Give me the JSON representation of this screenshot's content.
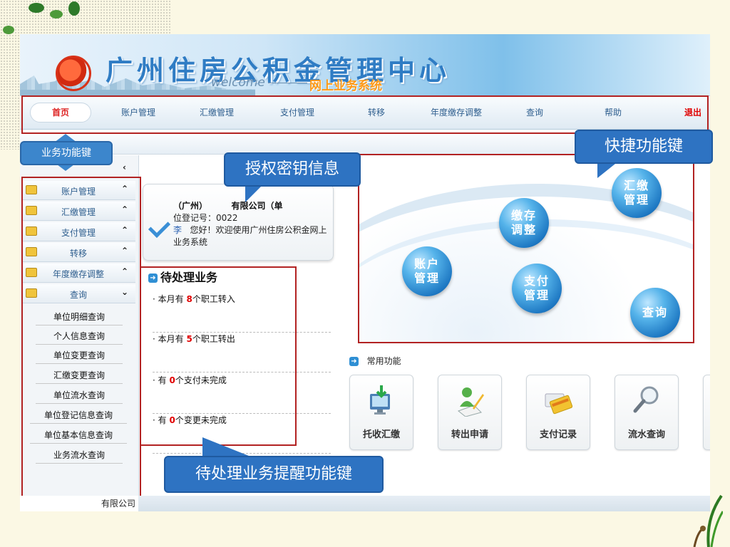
{
  "header": {
    "site_title": "广州住房公积金管理中心",
    "welcome": "welcome",
    "subtitle": "网上业务系统"
  },
  "nav": {
    "home": "首页",
    "items": [
      "账户管理",
      "汇缴管理",
      "支付管理",
      "转移",
      "年度缴存调整",
      "查询",
      "帮助"
    ],
    "exit": "退出"
  },
  "sidebar": {
    "menu": [
      "账户管理",
      "汇缴管理",
      "支付管理",
      "转移",
      "年度缴存调整",
      "查询"
    ],
    "query_submenu": [
      "单位明细查询",
      "个人信息查询",
      "单位变更查询",
      "汇缴变更查询",
      "单位流水查询",
      "单位登记信息查询",
      "单位基本信息查询",
      "业务流水查询"
    ],
    "footer": "有限公司"
  },
  "user_card": {
    "company_prefix": "（广州）",
    "company_suffix": "有限公司（单",
    "reg_line": "位登记号：0022",
    "user_name": "李",
    "greeting": "您好！欢迎使用广州住房公积金网上业务系统"
  },
  "todo": {
    "title": "待处理业务",
    "items": [
      {
        "prefix": "本月有",
        "count": "8",
        "suffix": "个职工转入"
      },
      {
        "prefix": "本月有",
        "count": "5",
        "suffix": "个职工转出"
      },
      {
        "prefix": "有",
        "count": "0",
        "suffix": "个支付未完成"
      },
      {
        "prefix": "有",
        "count": "0",
        "suffix": "个变更未完成"
      }
    ]
  },
  "shortcuts": {
    "account": "账户管理",
    "deposit_adjust": "缴存调整",
    "remit": "汇缴管理",
    "payment": "支付管理",
    "query": "查询"
  },
  "common": {
    "title": "常用功能",
    "buttons": [
      "托收汇缴",
      "转出申请",
      "支付记录",
      "流水查询"
    ]
  },
  "callouts": {
    "business_keys": "业务功能键",
    "auth_key_info": "授权密钥信息",
    "quick_keys": "快捷功能键",
    "todo_reminder": "待处理业务提醒功能键"
  },
  "colors": {
    "accent_blue": "#2e73c2",
    "highlight_red": "#b22222",
    "count_red": "#e00000"
  }
}
